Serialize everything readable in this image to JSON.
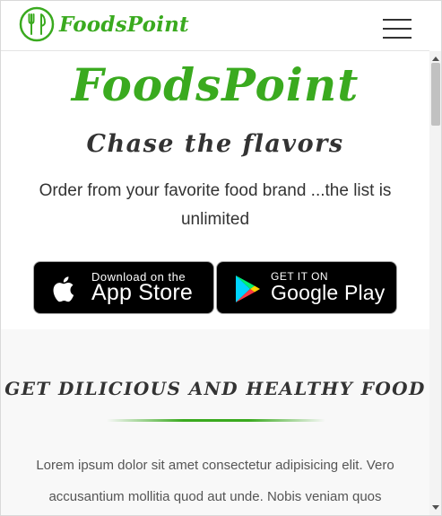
{
  "navbar": {
    "brand_name": "FoodsPoint",
    "logo_icon": "fork-knife-icon",
    "menu_icon": "hamburger-menu-icon"
  },
  "hero": {
    "title": "FoodsPoint",
    "tagline": "Chase the flavors",
    "description": "Order from your favorite food brand ...the list is unlimited"
  },
  "badges": {
    "apple": {
      "icon": "apple-icon",
      "small_text": "Download on the",
      "big_text": "App Store"
    },
    "google": {
      "icon": "google-play-icon",
      "small_text": "GET IT ON",
      "big_text": "Google Play"
    }
  },
  "features": {
    "heading": "GET DILICIOUS AND HEALTHY FOOD",
    "text": "Lorem ipsum dolor sit amet consectetur adipisicing elit. Vero accusantium mollitia quod aut unde. Nobis veniam quos"
  },
  "colors": {
    "brand_green": "#3aaa1f",
    "text_dark": "#333333",
    "section_bg": "#f8f8f8"
  }
}
